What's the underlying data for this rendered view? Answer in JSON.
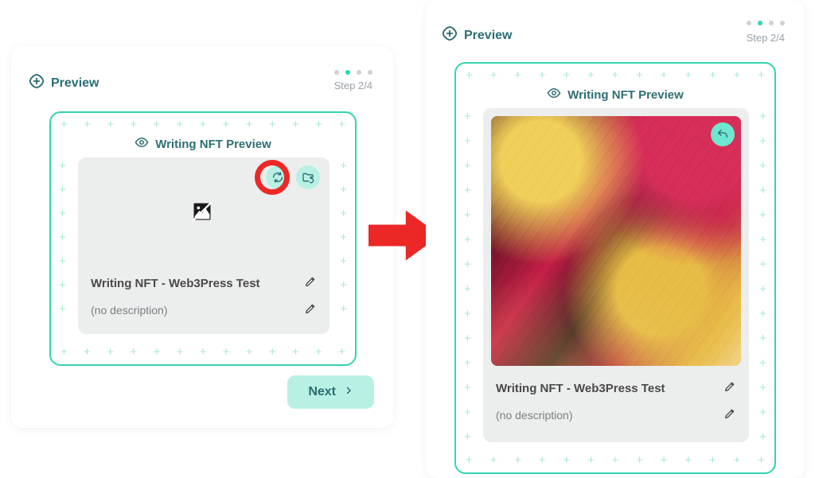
{
  "step": {
    "label": "Step 2/4"
  },
  "left": {
    "header": "Preview",
    "inner_title": "Writing NFT Preview",
    "title": "Writing NFT - Web3Press Test",
    "description": "(no description)",
    "next": "Next"
  },
  "right": {
    "header": "Preview",
    "inner_title": "Writing NFT Preview",
    "title": "Writing NFT - Web3Press Test",
    "description": "(no description)"
  },
  "icons": {
    "plus_circle": "plus-circle-icon",
    "eye": "eye-icon",
    "refresh": "refresh-icon",
    "folder": "folder-refresh-icon",
    "undo": "undo-icon",
    "pencil": "pencil-icon",
    "broken": "broken-image-icon",
    "chevron": "chevron-right-icon"
  },
  "colors": {
    "accent": "#34d4b1",
    "accent_fill": "#b8f1e4",
    "ring": "#ec2827",
    "teal_text": "#2a6b70"
  }
}
